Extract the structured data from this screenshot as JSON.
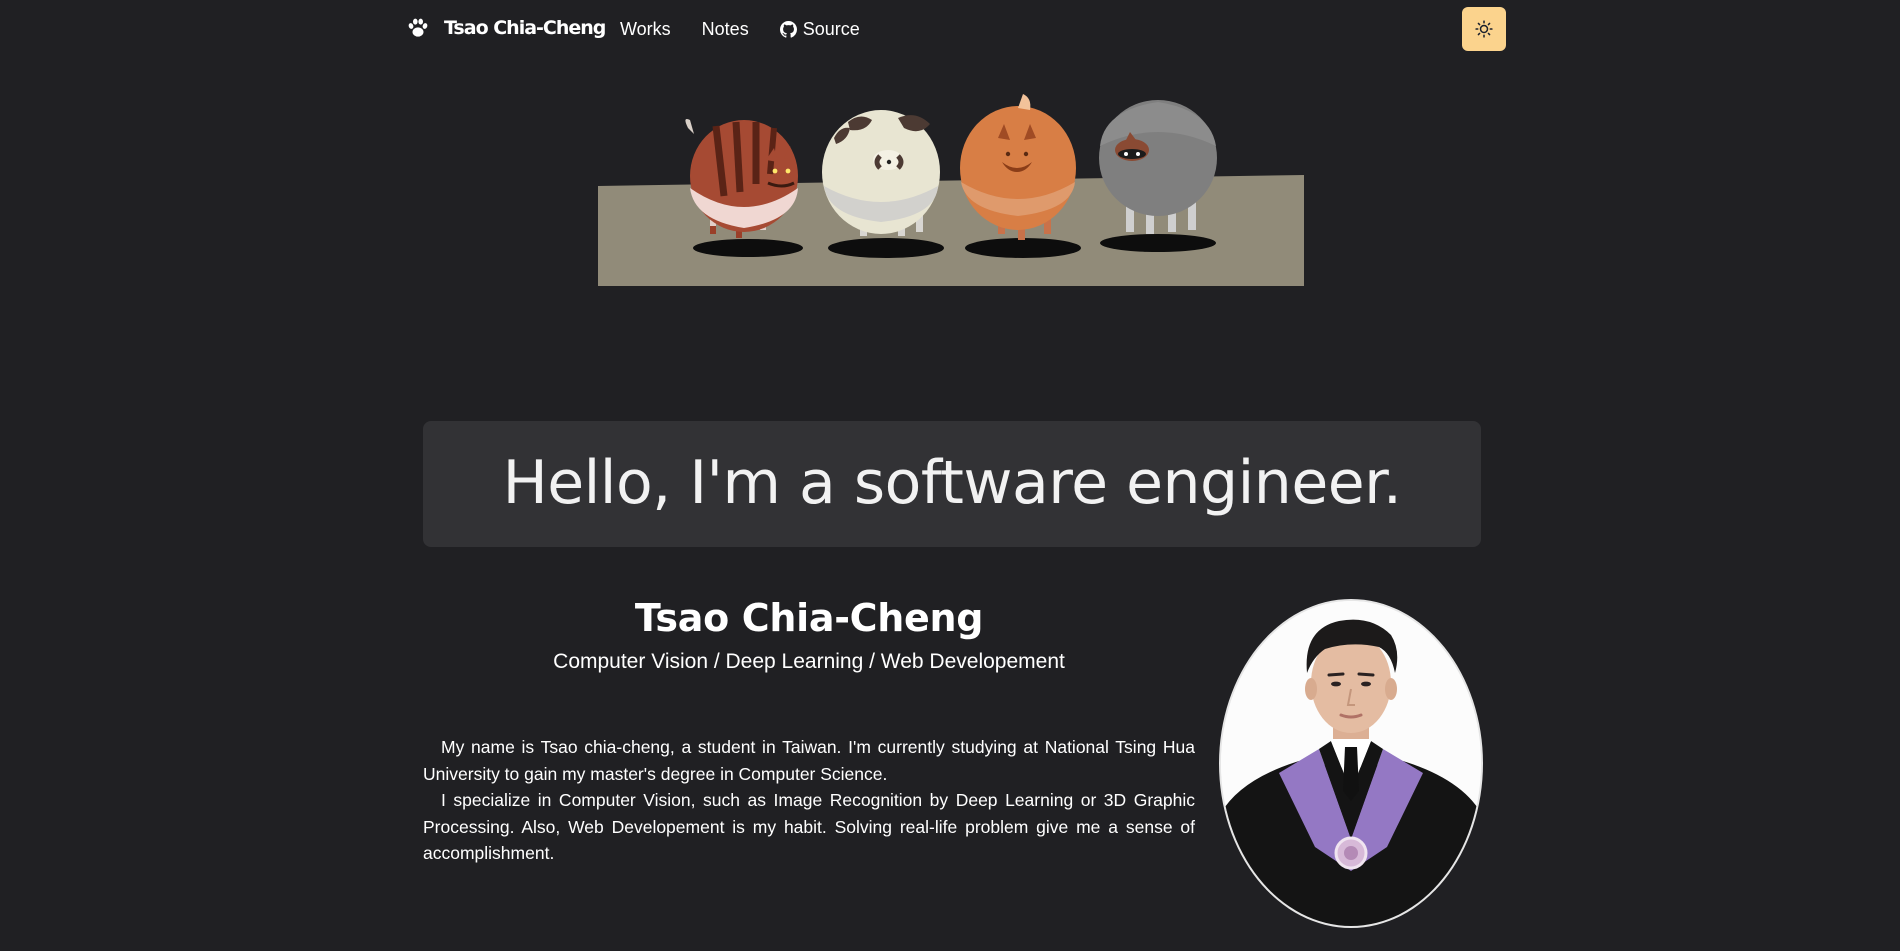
{
  "nav": {
    "brand": "Tsao Chia-Cheng",
    "brand_icon": "paw-icon",
    "links": [
      {
        "label": "Works"
      },
      {
        "label": "Notes"
      },
      {
        "label": "Source",
        "icon": "github-icon"
      }
    ],
    "theme_toggle_icon": "sun-icon",
    "theme_toggle_color": "#fbd38d"
  },
  "greeting": {
    "text": "Hello, I'm a software engineer."
  },
  "profile": {
    "name": "Tsao Chia-Cheng",
    "role": "Computer Vision / Deep Learning / Web Developement",
    "bio": [
      "My name is Tsao chia-cheng, a student in Taiwan. I'm currently studying at National Tsing Hua University to gain my master's degree in Computer Science.",
      "I specialize in Computer Vision, such as Image Recognition by Deep Learning or 3D Graphic Processing. Also, Web Developement is my habit. Solving real-life problem give me a sense of accomplishment."
    ]
  },
  "colors": {
    "background": "#202023",
    "card": "#323235",
    "accent": "#fbd38d"
  }
}
